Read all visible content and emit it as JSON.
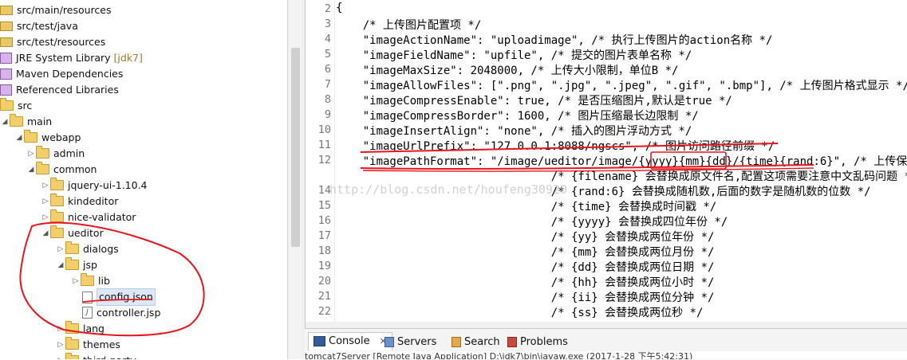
{
  "tree": {
    "items": [
      {
        "label": "src/main/resources",
        "deco": "",
        "icon": "pkgf"
      },
      {
        "label": "src/test/java",
        "deco": "",
        "icon": "pkgf"
      },
      {
        "label": "src/test/resources",
        "deco": "",
        "icon": "pkgf"
      },
      {
        "label": "JRE System Library",
        "deco": "[jdk7]",
        "icon": "lib"
      },
      {
        "label": "Maven Dependencies",
        "deco": "",
        "icon": "lib"
      },
      {
        "label": "Referenced Libraries",
        "deco": "",
        "icon": "lib"
      },
      {
        "label": "src",
        "deco": "",
        "icon": "folder"
      },
      {
        "label": "main",
        "deco": "",
        "icon": "folder"
      },
      {
        "label": "webapp",
        "deco": "",
        "icon": "folder"
      },
      {
        "label": "admin",
        "deco": "",
        "icon": "folder"
      },
      {
        "label": "common",
        "deco": "",
        "icon": "folder"
      },
      {
        "label": "jquery-ui-1.10.4",
        "deco": "",
        "icon": "folder"
      },
      {
        "label": "kindeditor",
        "deco": "",
        "icon": "folder"
      },
      {
        "label": "nice-validator",
        "deco": "",
        "icon": "folder"
      },
      {
        "label": "ueditor",
        "deco": "",
        "icon": "folder"
      },
      {
        "label": "dialogs",
        "deco": "",
        "icon": "folder"
      },
      {
        "label": "jsp",
        "deco": "",
        "icon": "folder"
      },
      {
        "label": "lib",
        "deco": "",
        "icon": "folder"
      },
      {
        "label": "config.json",
        "deco": "",
        "icon": "file"
      },
      {
        "label": "controller.jsp",
        "deco": "",
        "icon": "jsp"
      },
      {
        "label": "lang",
        "deco": "",
        "icon": "folder"
      },
      {
        "label": "themes",
        "deco": "",
        "icon": "folder"
      },
      {
        "label": "third-party",
        "deco": "",
        "icon": "folder"
      }
    ]
  },
  "editor": {
    "lines": [
      {
        "n": "2",
        "code": "{"
      },
      {
        "n": "3",
        "code": "    /* 上传图片配置项 */"
      },
      {
        "n": "4",
        "code": "    \"imageActionName\": \"uploadimage\", /* 执行上传图片的action名称 */"
      },
      {
        "n": "5",
        "code": "    \"imageFieldName\": \"upfile\", /* 提交的图片表单名称 */"
      },
      {
        "n": "6",
        "code": "    \"imageMaxSize\": 2048000, /* 上传大小限制，单位B */"
      },
      {
        "n": "7",
        "code": "    \"imageAllowFiles\": [\".png\", \".jpg\", \".jpeg\", \".gif\", \".bmp\"], /* 上传图片格式显示 */"
      },
      {
        "n": "8",
        "code": "    \"imageCompressEnable\": true, /* 是否压缩图片,默认是true */"
      },
      {
        "n": "9",
        "code": "    \"imageCompressBorder\": 1600, /* 图片压缩最长边限制 */"
      },
      {
        "n": "10",
        "code": "    \"imageInsertAlign\": \"none\", /* 插入的图片浮动方式 */"
      },
      {
        "n": "11",
        "code": "    \"imageUrlPrefix\": \"127.0.0.1:8088/ngscs\", /* 图片访问路径前缀 */"
      },
      {
        "n": "12",
        "code": "    \"imagePathFormat\": \"/image/ueditor/image/{yyyy}{mm}{dd}/{time}{rand:6}\", /* 上传保存路径,可以自定义保存路径和文件名格式 */"
      },
      {
        "n": "",
        "code": "                                /* {filename} 会替换成原文件名,配置这项需要注意中文乱码问题 */"
      },
      {
        "n": "14",
        "code": "                                /* {rand:6} 会替换成随机数,后面的数字是随机数的位数 */"
      },
      {
        "n": "15",
        "code": "                                /* {time} 会替换成时间戳 */"
      },
      {
        "n": "16",
        "code": "                                /* {yyyy} 会替换成四位年份 */"
      },
      {
        "n": "17",
        "code": "                                /* {yy} 会替换成两位年份 */"
      },
      {
        "n": "18",
        "code": "                                /* {mm} 会替换成两位月份 */"
      },
      {
        "n": "19",
        "code": "                                /* {dd} 会替换成两位日期 */"
      },
      {
        "n": "20",
        "code": "                                /* {hh} 会替换成两位小时 */"
      },
      {
        "n": "21",
        "code": "                                /* {ii} 会替换成两位分钟 */"
      },
      {
        "n": "22",
        "code": "                                /* {ss} 会替换成两位秒 */"
      }
    ]
  },
  "watermark": "http://blog.csdn.net/houfeng30920",
  "console": {
    "tabs": [
      {
        "label": "Console",
        "close": "✕"
      },
      {
        "label": "Servers"
      },
      {
        "label": "Search"
      },
      {
        "label": "Problems"
      }
    ],
    "status": "tomcat7Server [Remote Java Application] D:\\jdk7\\bin\\javaw.exe (2017-1-28 下午5:42:31)"
  },
  "colors": {
    "annotation": "#e8151b",
    "selection": "#dde8f6"
  }
}
